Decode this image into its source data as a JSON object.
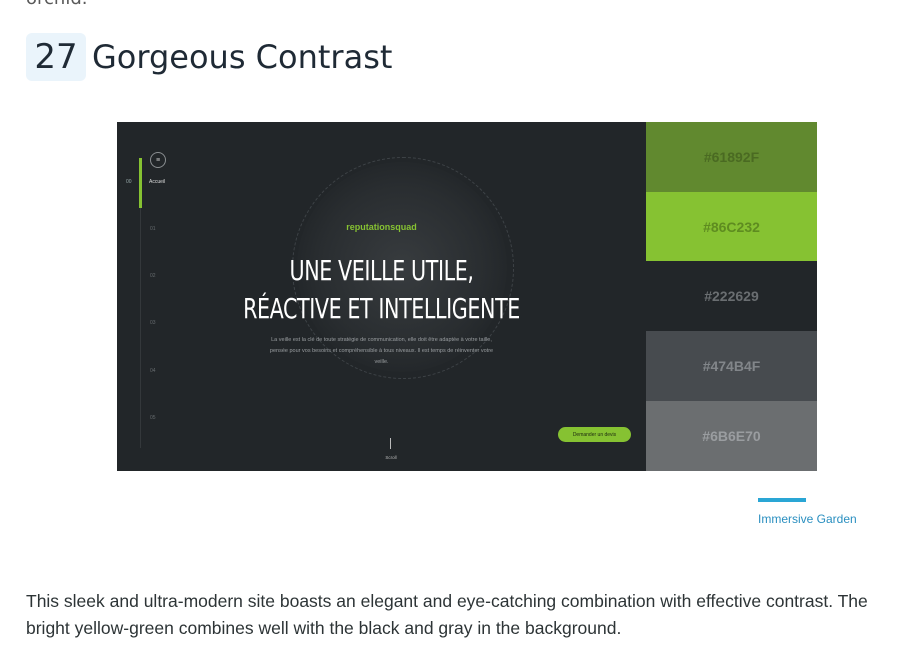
{
  "prev_cut_text": "orchid.",
  "section": {
    "number": "27",
    "title": "Gorgeous Contrast"
  },
  "screenshot": {
    "nav": {
      "active_num": "00",
      "active_label": "Accueil",
      "other_nums": [
        "01",
        "02",
        "03",
        "04",
        "05"
      ]
    },
    "brand": "reputationsquad",
    "headline_line1": "UNE VEILLE UTILE,",
    "headline_line2": "RÉACTIVE ET INTELLIGENTE",
    "paragraph": "La veille est la clé de toute stratégie de communication, elle doit être adaptée à votre taille, pensée pour vos besoins et compréhensible à tous niveaux. Il est temps de réinventer votre veille.",
    "cta_label": "Demander un devis",
    "scroll_label": "Scroll"
  },
  "palette": [
    {
      "hex": "#61892F",
      "color": "#61892F",
      "text_color": "#4a6a22"
    },
    {
      "hex": "#86C232",
      "color": "#86C232",
      "text_color": "#5e8c20"
    },
    {
      "hex": "#222629",
      "color": "#222629",
      "text_color": "#6a6e71"
    },
    {
      "hex": "#474B4F",
      "color": "#474B4F",
      "text_color": "#82868a"
    },
    {
      "hex": "#6B6E70",
      "color": "#6B6E70",
      "text_color": "#9a9da0"
    }
  ],
  "credit": "Immersive Garden",
  "description": "This sleek and ultra-modern site boasts an elegant and eye-catching combination with effective contrast. The bright yellow-green combines well with the black and gray in the background."
}
